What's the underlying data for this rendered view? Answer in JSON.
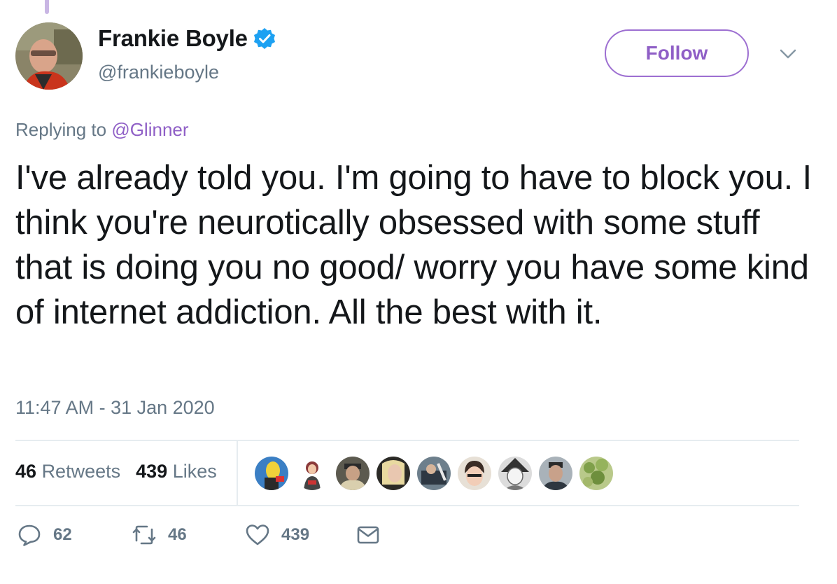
{
  "tweet": {
    "display_name": "Frankie Boyle",
    "handle": "@frankieboyle",
    "follow_label": "Follow",
    "replying_prefix": "Replying to",
    "replying_to": "@Glinner",
    "text": "I've already told you. I'm going to have to block you. I think you're neurotically obsessed with some stuff that is doing you no good/ worry you have some kind of internet addiction. All the best with it.",
    "timestamp": "11:47 AM - 31 Jan 2020"
  },
  "stats": {
    "retweets_count": "46",
    "retweets_label": "Retweets",
    "likes_count": "439",
    "likes_label": "Likes"
  },
  "actions": {
    "reply_count": "62",
    "retweet_count": "46",
    "like_count": "439"
  },
  "colors": {
    "accent": "#8f5fc6",
    "verified": "#1da1f2",
    "muted_text": "#657786"
  }
}
